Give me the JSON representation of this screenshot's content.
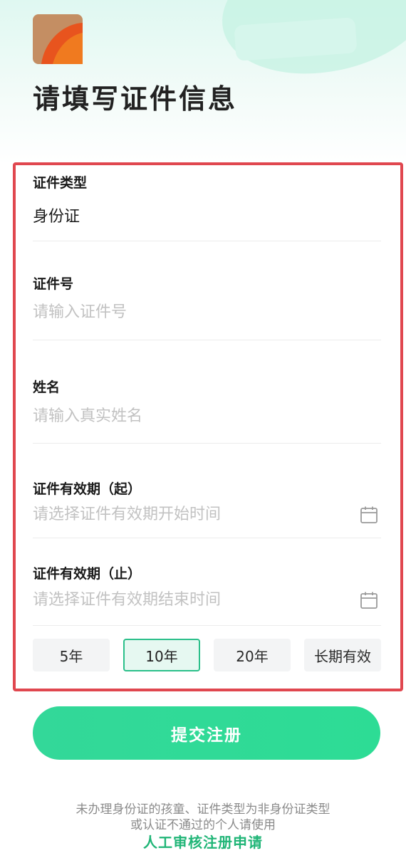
{
  "page": {
    "title": "请填写证件信息"
  },
  "form": {
    "id_type": {
      "label": "证件类型",
      "value": "身份证"
    },
    "id_number": {
      "label": "证件号",
      "placeholder": "请输入证件号",
      "value": ""
    },
    "name": {
      "label": "姓名",
      "placeholder": "请输入真实姓名",
      "value": ""
    },
    "valid_from": {
      "label": "证件有效期（起）",
      "placeholder": "请选择证件有效期开始时间",
      "icon": "calendar-icon"
    },
    "valid_to": {
      "label": "证件有效期（止）",
      "placeholder": "请选择证件有效期结束时间",
      "icon": "calendar-icon"
    },
    "durations": [
      {
        "label": "5年",
        "selected": false
      },
      {
        "label": "10年",
        "selected": true
      },
      {
        "label": "20年",
        "selected": false
      },
      {
        "label": "长期有效",
        "selected": false
      }
    ]
  },
  "submit": {
    "label": "提交注册"
  },
  "footer": {
    "note_line1": "未办理身份证的孩童、证件类型为非身份证类型",
    "note_line2": "或认证不通过的个人请使用",
    "link": "人工审核注册申请"
  },
  "colors": {
    "accent": "#2ddc95",
    "link": "#20b577",
    "highlight_border": "#e0474f"
  }
}
